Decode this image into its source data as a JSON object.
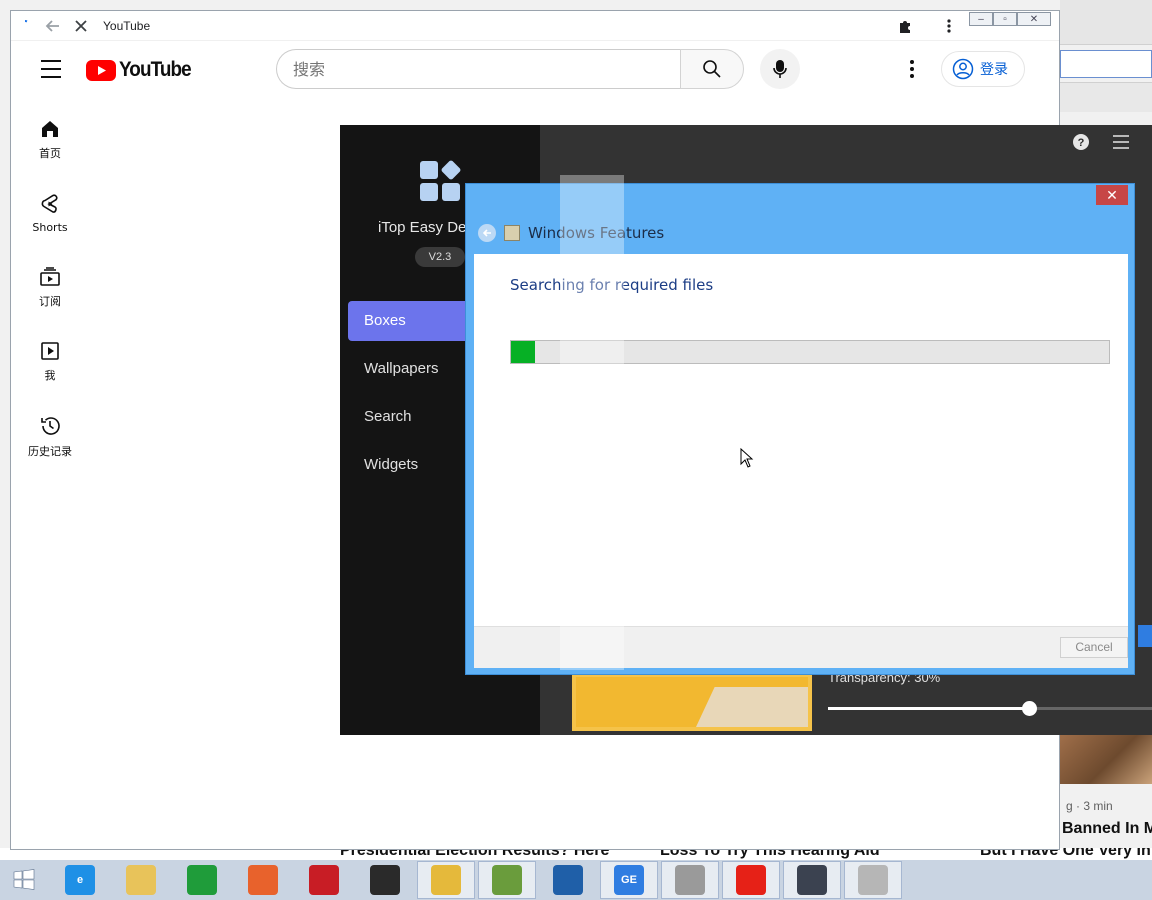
{
  "background": {
    "meta": "g · 3 min",
    "title_right": "Banned In M",
    "bottom_titles": [
      "Presidential Election Results? Here",
      "Loss To Try This Hearing Aid",
      "But I Have One Very In"
    ]
  },
  "browser": {
    "tab_title": "YouTube",
    "window_controls": [
      "–",
      "▫",
      "✕"
    ]
  },
  "youtube": {
    "logo_text": "YouTube",
    "search_placeholder": "搜索",
    "signin_label": "登录",
    "sidebar": [
      {
        "label": "首页",
        "icon": "home-icon"
      },
      {
        "label": "Shorts",
        "icon": "shorts-icon"
      },
      {
        "label": "订阅",
        "icon": "subscriptions-icon"
      },
      {
        "label": "我",
        "icon": "library-icon"
      },
      {
        "label": "历史记录",
        "icon": "history-icon"
      }
    ]
  },
  "itop": {
    "app_name": "iTop Easy De",
    "version": "V2.3",
    "nav": [
      "Boxes",
      "Wallpapers",
      "Search",
      "Widgets"
    ],
    "active_nav": "Boxes",
    "transparency_label": "Transparency: 30%",
    "slider_value": 0.62,
    "accent_color": "#6c74ec"
  },
  "dialog": {
    "title": "Windows Features",
    "status": "Searching for required files",
    "progress": 0.04,
    "cancel_label": "Cancel",
    "close_label": "✕"
  },
  "taskbar": {
    "items": [
      {
        "name": "start-button",
        "label": "",
        "color": "#ffffff"
      },
      {
        "name": "internet-explorer",
        "label": "e",
        "color": "#1e90e6"
      },
      {
        "name": "file-explorer",
        "label": "",
        "color": "#e8c35a"
      },
      {
        "name": "windows-store",
        "label": "",
        "color": "#1f9c3a"
      },
      {
        "name": "firefox",
        "label": "",
        "color": "#e8622c"
      },
      {
        "name": "itop-screen-recorder",
        "label": "",
        "color": "#c81d25"
      },
      {
        "name": "screen-recorder",
        "label": "",
        "color": "#2a2a2a"
      },
      {
        "name": "chrome",
        "label": "",
        "color": "#e5b93b"
      },
      {
        "name": "game-app",
        "label": "",
        "color": "#6a9c3c"
      },
      {
        "name": "blue-app",
        "label": "",
        "color": "#1f5fa8"
      },
      {
        "name": "ge-app",
        "label": "GE",
        "color": "#2f7de1"
      },
      {
        "name": "tool-app",
        "label": "",
        "color": "#9a9a9a"
      },
      {
        "name": "youtube-app",
        "label": "",
        "color": "#e62117"
      },
      {
        "name": "itop-easy-desktop",
        "label": "",
        "color": "#3b4250"
      },
      {
        "name": "windows-features-app",
        "label": "",
        "color": "#b6b6b6"
      }
    ]
  }
}
